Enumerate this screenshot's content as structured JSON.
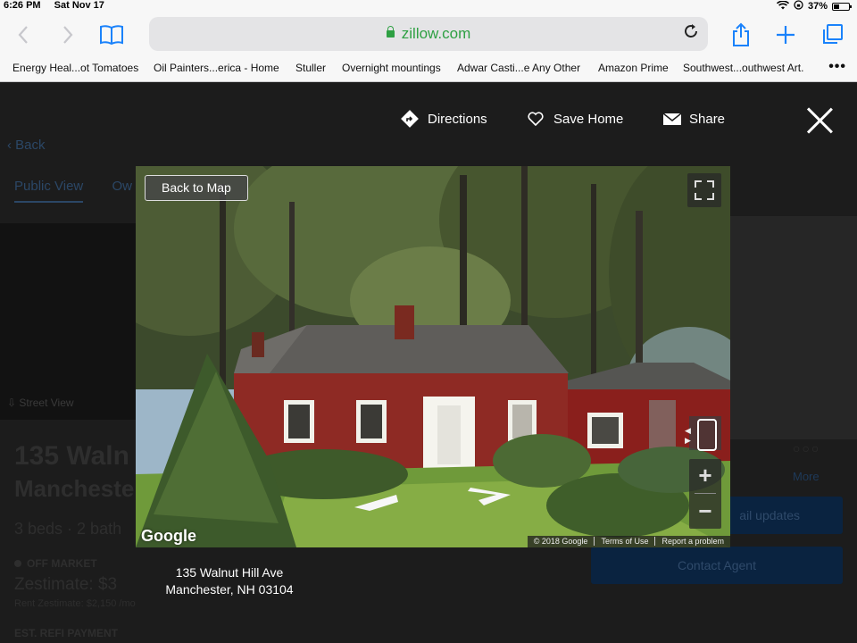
{
  "status_bar": {
    "time": "6:26 PM",
    "date": "Sat Nov 17",
    "battery": "37%"
  },
  "safari": {
    "url": "zillow.com",
    "icons": [
      "back-icon",
      "forward-icon",
      "bookmarks-book-icon",
      "lock-icon",
      "reload-icon",
      "share-icon",
      "new-tab-plus-icon",
      "tabs-icon"
    ]
  },
  "bookmarks": [
    "Energy Heal...ot Tomatoes",
    "Oil Painters...erica - Home",
    "Stuller",
    "Overnight mountings",
    "Adwar Casti...e Any Other",
    "Amazon Prime",
    "Southwest...outhwest Art."
  ],
  "background_page": {
    "back": "Back",
    "tabs": [
      "Public View",
      "Ow"
    ],
    "street_view": "Street View",
    "address_line1": "135 Waln",
    "address_line2": "Mancheste",
    "beds_baths": "3 beds · 2 bath",
    "status": "OFF MARKET",
    "zestimate": "Zestimate: $3",
    "rent_zestimate": "Rent Zestimate: $2,150 /mo",
    "refi": "EST. REFI PAYMENT",
    "more": "More",
    "email_updates": "ail updates",
    "contact_agent": "Contact Agent"
  },
  "modal": {
    "directions": "Directions",
    "save_home": "Save Home",
    "share": "Share",
    "back_to_map": "Back to Map",
    "google": "Google",
    "copyright": "© 2018 Google",
    "terms": "Terms of Use",
    "report": "Report a problem",
    "address_line1": "135 Walnut Hill Ave",
    "address_line2": "Manchester, NH 03104"
  },
  "colors": {
    "url_green": "#2ea043",
    "ios_blue": "#1a82fb",
    "house_red": "#8e2a24",
    "overlay_dark": "#1b1b1b"
  }
}
